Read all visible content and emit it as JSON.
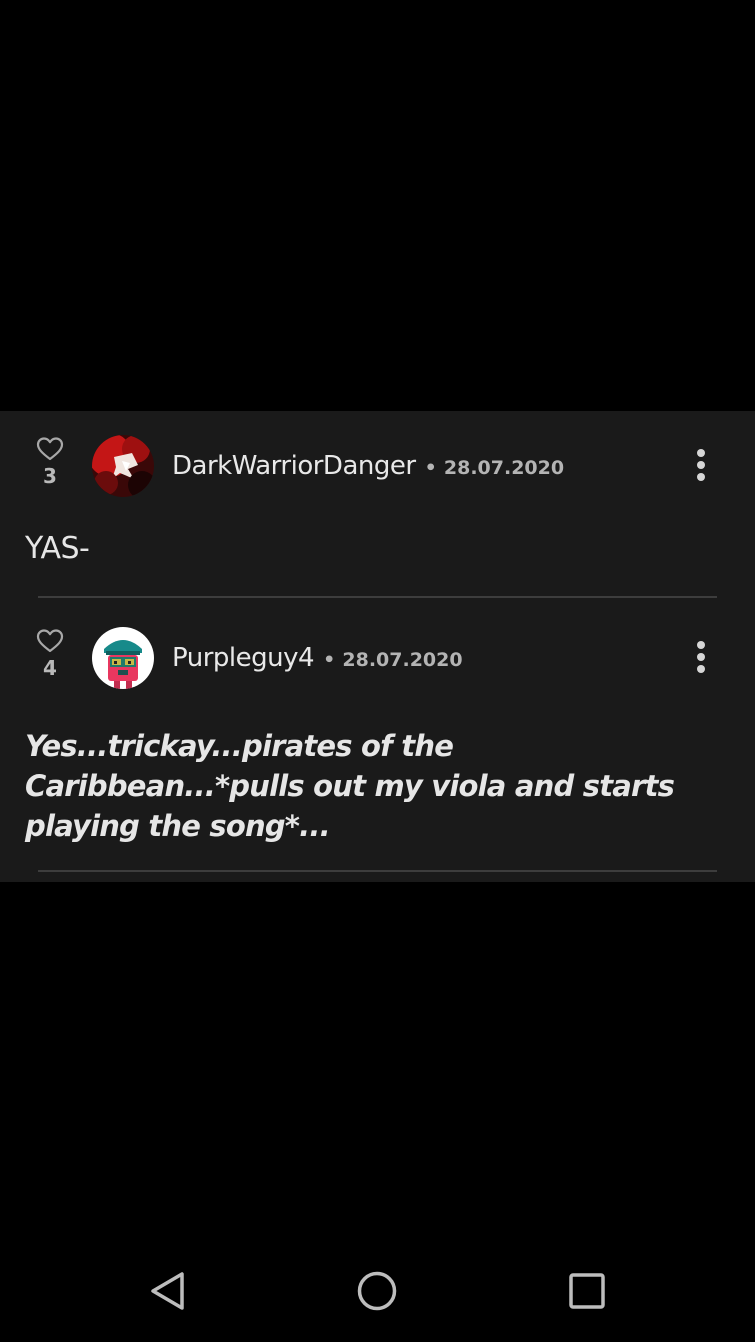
{
  "comments": [
    {
      "likes": "3",
      "username": "DarkWarriorDanger",
      "separator": "•",
      "date": "28.07.2020",
      "text": "YAS-",
      "avatar_colors": [
        "#d81818",
        "#3a0808",
        "#f0e6e0"
      ]
    },
    {
      "likes": "4",
      "username": "Purpleguy4",
      "separator": "•",
      "date": "28.07.2020",
      "text": "Yes...trickay...pirates of the Caribbean...*pulls out my viola and starts playing the song*...",
      "avatar_colors": [
        "#e8375f",
        "#178a8a",
        "#c7b846"
      ]
    }
  ],
  "icons": {
    "like": "heart-outline-icon",
    "menu": "more-vertical-icon",
    "nav_back": "triangle-back-icon",
    "nav_home": "circle-home-icon",
    "nav_recents": "square-recents-icon"
  },
  "colors": {
    "background": "#000000",
    "panel": "#1a1a1a",
    "text": "#e6e6e6",
    "muted": "#b4b4b4",
    "divider": "#3d3d3d"
  }
}
